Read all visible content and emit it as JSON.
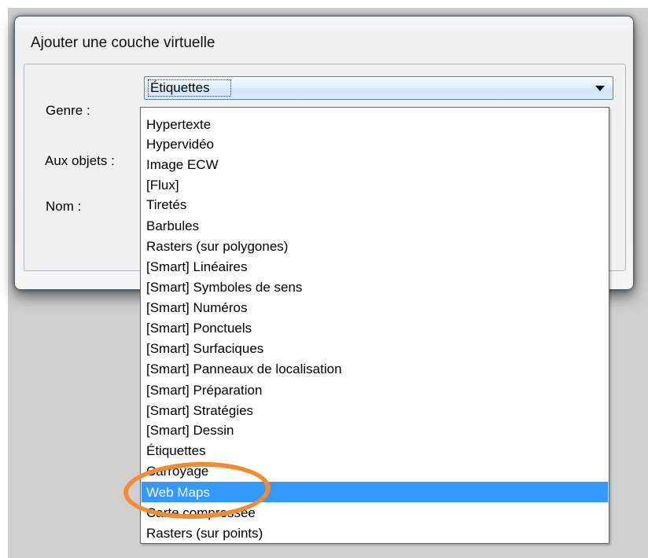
{
  "dialog": {
    "title": "Ajouter une couche virtuelle",
    "labels": {
      "genre": "Genre :",
      "objects": "Aux objets :",
      "name": "Nom :"
    }
  },
  "combo": {
    "selected": "Étiquettes",
    "open": true
  },
  "options": [
    "Hypertexte",
    "Hypervidéo",
    "Image ECW",
    "[Flux]",
    "Tiretés",
    "Barbules",
    "Rasters (sur polygones)",
    "[Smart] Linéaires",
    "[Smart] Symboles de sens",
    "[Smart] Numéros",
    "[Smart] Ponctuels",
    "[Smart] Surfaciques",
    "[Smart] Panneaux de localisation",
    "[Smart] Préparation",
    "[Smart] Stratégies",
    "[Smart] Dessin",
    "Étiquettes",
    "Carroyage",
    "Web Maps",
    "Carte compressée",
    "Rasters (sur points)"
  ],
  "highlighted_option": "Web Maps",
  "icons": {
    "dropdown": "chevron-down-icon"
  },
  "colors": {
    "selection": "#3399ff",
    "annotation": "#f48b2e",
    "combo_border": "#5b86b5"
  }
}
